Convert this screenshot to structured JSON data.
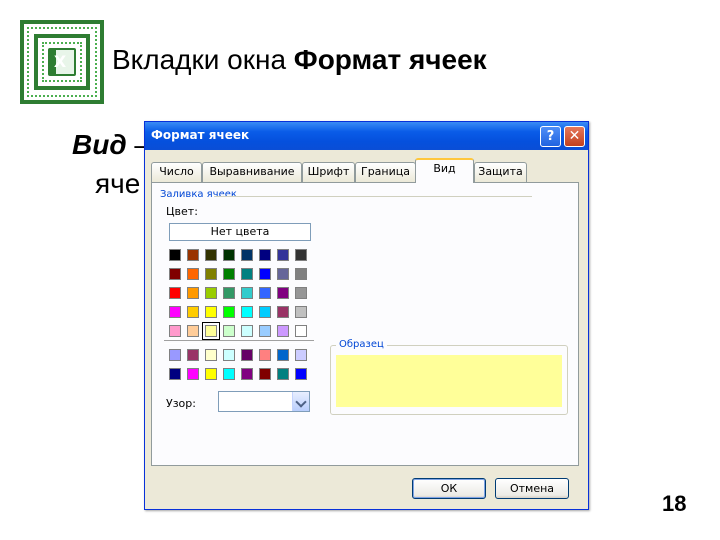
{
  "slide": {
    "title_prefix": "Вкладки окна ",
    "title_bold": "Формат ячеек",
    "text1_bold": "Вид",
    "text1_rest": " –",
    "text2": "яче",
    "page_number": "18"
  },
  "dialog": {
    "title": "Формат ячеек",
    "help_label": "?",
    "close_label": "✕",
    "tabs": [
      {
        "label": "Число"
      },
      {
        "label": "Выравнивание"
      },
      {
        "label": "Шрифт"
      },
      {
        "label": "Граница"
      },
      {
        "label": "Вид",
        "active": true
      },
      {
        "label": "Защита"
      }
    ],
    "fill_group_label": "Заливка ячеек",
    "color_label": "Цвет:",
    "no_color_label": "Нет цвета",
    "pattern_label": "Узор:",
    "pattern_value": "",
    "sample_label": "Образец",
    "sample_color": "#FFFF99",
    "ok_label": "ОК",
    "cancel_label": "Отмена",
    "selected_color": "#FFFF99",
    "palette_main": [
      [
        "#000000",
        "#993300",
        "#333300",
        "#003300",
        "#003366",
        "#000080",
        "#333399",
        "#333333"
      ],
      [
        "#800000",
        "#FF6600",
        "#808000",
        "#008000",
        "#008080",
        "#0000FF",
        "#666699",
        "#808080"
      ],
      [
        "#FF0000",
        "#FF9900",
        "#99CC00",
        "#339966",
        "#33CCCC",
        "#3366FF",
        "#800080",
        "#969696"
      ],
      [
        "#FF00FF",
        "#FFCC00",
        "#FFFF00",
        "#00FF00",
        "#00FFFF",
        "#00CCFF",
        "#993366",
        "#C0C0C0"
      ],
      [
        "#FF99CC",
        "#FFCC99",
        "#FFFF99",
        "#CCFFCC",
        "#CCFFFF",
        "#99CCFF",
        "#CC99FF",
        "#FFFFFF"
      ]
    ],
    "palette_extra": [
      [
        "#9999FF",
        "#993366",
        "#FFFFCC",
        "#CCFFFF",
        "#660066",
        "#FF8080",
        "#0066CC",
        "#CCCCFF"
      ],
      [
        "#000080",
        "#FF00FF",
        "#FFFF00",
        "#00FFFF",
        "#800080",
        "#800000",
        "#008080",
        "#0000FF"
      ]
    ]
  },
  "colors": {
    "titlebar": "#0A5CE8",
    "logo_green": "#2E7D32"
  }
}
